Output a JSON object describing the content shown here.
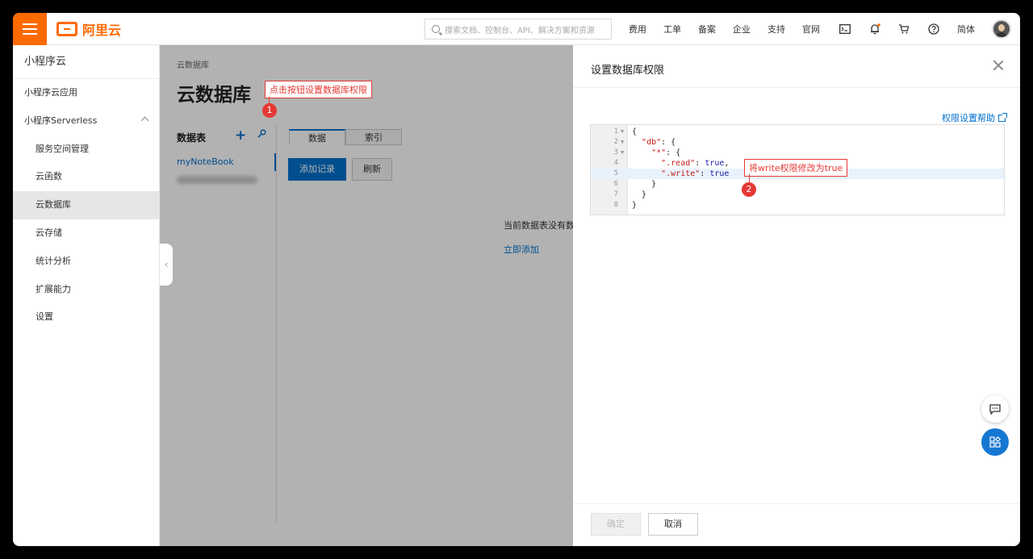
{
  "topbar": {
    "brand": "阿里云",
    "search_placeholder": "搜索文档、控制台、API、解决方案和资源",
    "nav": [
      "费用",
      "工单",
      "备案",
      "企业",
      "支持",
      "官网"
    ],
    "lang": "简体",
    "icons": [
      "terminal-icon",
      "bell-icon",
      "cart-icon",
      "help-icon"
    ]
  },
  "sidebar": {
    "title": "小程序云",
    "items": [
      {
        "label": "小程序云应用"
      },
      {
        "label": "小程序Serverless"
      },
      {
        "label": "服务空间管理"
      },
      {
        "label": "云函数"
      },
      {
        "label": "云数据库"
      },
      {
        "label": "云存储"
      },
      {
        "label": "统计分析"
      },
      {
        "label": "扩展能力"
      },
      {
        "label": "设置"
      }
    ]
  },
  "main": {
    "breadcrumb": "云数据库",
    "title": "云数据库",
    "table_header": "数据表",
    "table_item": "myNoteBook",
    "tabs": [
      "数据",
      "索引"
    ],
    "add_record": "添加记录",
    "refresh": "刷新",
    "empty_msg": "当前数据表没有数",
    "add_now": "立即添加"
  },
  "annotations": {
    "callout1": "点击按钮设置数据库权限",
    "badge1": "1",
    "callout2": "将write权限修改为true",
    "badge2": "2"
  },
  "drawer": {
    "title": "设置数据库权限",
    "help_link": "权限设置帮助",
    "code_lines": [
      "1",
      "2",
      "3",
      "4",
      "5",
      "6",
      "7",
      "8"
    ],
    "ok": "确定",
    "cancel": "取消"
  },
  "colors": {
    "brand": "#ff6a00",
    "link": "#0070cc",
    "annotation": "#e53935"
  }
}
